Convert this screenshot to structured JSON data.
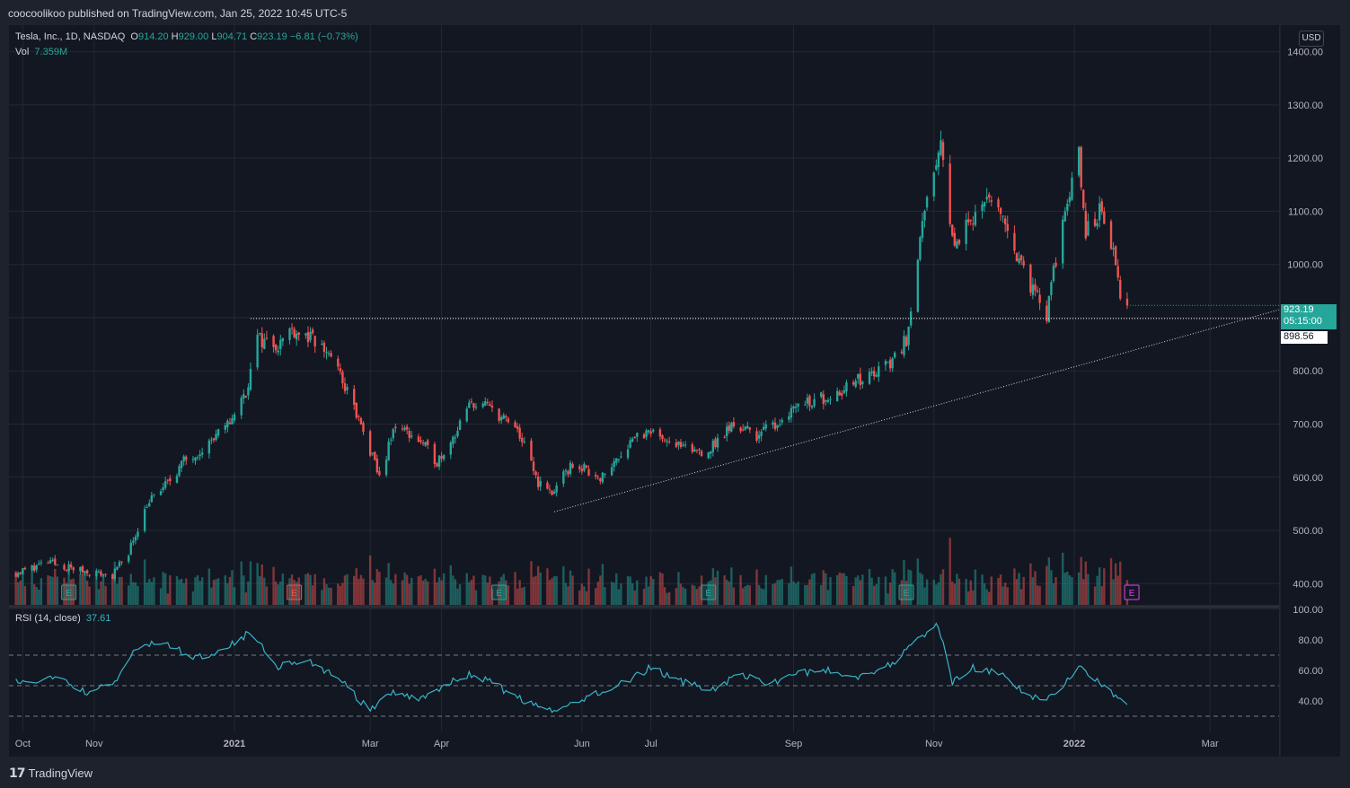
{
  "header": {
    "publisher": "coocoolikoo published on TradingView.com, Jan 25, 2022 10:45 UTC-5"
  },
  "legend": {
    "symbol": "Tesla, Inc., 1D, NASDAQ",
    "o_label": "O",
    "o_value": "914.20",
    "h_label": "H",
    "h_value": "929.00",
    "l_label": "L",
    "l_value": "904.71",
    "c_label": "C",
    "c_value": "923.19",
    "change": "−6.81 (−0.73%)",
    "vol_label": "Vol",
    "vol_value": "7.359M",
    "rsi_label": "RSI (14, close)",
    "rsi_value": "37.61"
  },
  "price_scale": {
    "currency": "USD",
    "last_price": "923.19",
    "countdown": "05:15:00",
    "reference_price": "898.56"
  },
  "footer": {
    "brand": "TradingView"
  },
  "colors": {
    "background": "#131722",
    "up": "#26a69a",
    "down": "#ef5350",
    "rsi": "#38b4c4",
    "earnings_up": "#26a69a",
    "earnings_down": "#ef5350",
    "earnings_upcoming": "#e040fb"
  },
  "chart_data": [
    {
      "type": "candlestick",
      "title": "Tesla, Inc., 1D, NASDAQ",
      "ylim": [
        360,
        1450
      ],
      "y_ticks": [
        "1400.00",
        "1300.00",
        "1200.00",
        "1100.00",
        "1000.00",
        "900.00",
        "800.00",
        "700.00",
        "600.00",
        "500.00",
        "400.00"
      ],
      "x_ticks": [
        "Oct",
        "Nov",
        "2021",
        "Mar",
        "Apr",
        "Jun",
        "Jul",
        "Sep",
        "Nov",
        "2022",
        "Mar"
      ],
      "x_range": [
        "2020-09-25",
        "2022-03-31"
      ],
      "x_tick_dates": [
        "2020-10-01",
        "2020-11-01",
        "2021-01-01",
        "2021-03-01",
        "2021-04-01",
        "2021-06-01",
        "2021-07-01",
        "2021-09-01",
        "2021-11-01",
        "2022-01-01",
        "2022-03-01"
      ],
      "price_path": [
        [
          "2020-09-28",
          420
        ],
        [
          "2020-10-12",
          440
        ],
        [
          "2020-10-26",
          425
        ],
        [
          "2020-11-09",
          415
        ],
        [
          "2020-11-16",
          460
        ],
        [
          "2020-11-24",
          550
        ],
        [
          "2020-12-02",
          585
        ],
        [
          "2020-12-10",
          630
        ],
        [
          "2020-12-18",
          655
        ],
        [
          "2020-12-28",
          690
        ],
        [
          "2021-01-06",
          760
        ],
        [
          "2021-01-11",
          860
        ],
        [
          "2021-01-20",
          850
        ],
        [
          "2021-01-26",
          880
        ],
        [
          "2021-02-03",
          860
        ],
        [
          "2021-02-12",
          830
        ],
        [
          "2021-02-22",
          730
        ],
        [
          "2021-03-05",
          600
        ],
        [
          "2021-03-12",
          700
        ],
        [
          "2021-03-22",
          670
        ],
        [
          "2021-03-30",
          630
        ],
        [
          "2021-04-08",
          690
        ],
        [
          "2021-04-14",
          740
        ],
        [
          "2021-04-23",
          730
        ],
        [
          "2021-05-05",
          680
        ],
        [
          "2021-05-13",
          590
        ],
        [
          "2021-05-19",
          570
        ],
        [
          "2021-05-28",
          625
        ],
        [
          "2021-06-10",
          600
        ],
        [
          "2021-06-24",
          680
        ],
        [
          "2021-07-06",
          680
        ],
        [
          "2021-07-16",
          650
        ],
        [
          "2021-07-26",
          650
        ],
        [
          "2021-08-06",
          700
        ],
        [
          "2021-08-16",
          680
        ],
        [
          "2021-08-24",
          700
        ],
        [
          "2021-09-03",
          740
        ],
        [
          "2021-09-14",
          750
        ],
        [
          "2021-09-24",
          770
        ],
        [
          "2021-10-04",
          790
        ],
        [
          "2021-10-13",
          815
        ],
        [
          "2021-10-20",
          860
        ],
        [
          "2021-10-25",
          1020
        ],
        [
          "2021-10-29",
          1110
        ],
        [
          "2021-11-04",
          1220
        ],
        [
          "2021-11-10",
          1030
        ],
        [
          "2021-11-17",
          1090
        ],
        [
          "2021-11-24",
          1120
        ],
        [
          "2021-12-02",
          1080
        ],
        [
          "2021-12-08",
          1010
        ],
        [
          "2021-12-14",
          950
        ],
        [
          "2021-12-20",
          900
        ],
        [
          "2021-12-27",
          1090
        ],
        [
          "2022-01-03",
          1200
        ],
        [
          "2022-01-06",
          1060
        ],
        [
          "2022-01-12",
          1100
        ],
        [
          "2022-01-18",
          1020
        ],
        [
          "2022-01-21",
          945
        ],
        [
          "2022-01-24",
          923.19
        ]
      ],
      "reference_level": 898.56,
      "trendline": [
        [
          "2021-05-20",
          535
        ],
        [
          "2022-03-31",
          915
        ]
      ],
      "earnings_markers": [
        {
          "date": "2020-10-21",
          "label": "E",
          "kind": "up"
        },
        {
          "date": "2021-01-27",
          "label": "E",
          "kind": "down"
        },
        {
          "date": "2021-04-26",
          "label": "E",
          "kind": "up"
        },
        {
          "date": "2021-07-26",
          "label": "E",
          "kind": "up"
        },
        {
          "date": "2021-10-20",
          "label": "E",
          "kind": "up"
        },
        {
          "date": "2022-01-26",
          "label": "E",
          "kind": "upcoming"
        }
      ]
    },
    {
      "type": "line",
      "title": "RSI (14, close)",
      "ylim": [
        20,
        100
      ],
      "y_ticks": [
        "100.00",
        "80.00",
        "60.00",
        "40.00"
      ],
      "bands": [
        30,
        50,
        70
      ],
      "rsi_path": [
        [
          "2020-09-28",
          52
        ],
        [
          "2020-10-15",
          55
        ],
        [
          "2020-10-30",
          45
        ],
        [
          "2020-11-10",
          52
        ],
        [
          "2020-11-20",
          76
        ],
        [
          "2020-12-01",
          78
        ],
        [
          "2020-12-15",
          68
        ],
        [
          "2020-12-28",
          75
        ],
        [
          "2021-01-08",
          85
        ],
        [
          "2021-01-20",
          63
        ],
        [
          "2021-02-01",
          67
        ],
        [
          "2021-02-15",
          55
        ],
        [
          "2021-03-01",
          33
        ],
        [
          "2021-03-10",
          45
        ],
        [
          "2021-03-22",
          42
        ],
        [
          "2021-04-05",
          52
        ],
        [
          "2021-04-15",
          58
        ],
        [
          "2021-04-27",
          48
        ],
        [
          "2021-05-10",
          38
        ],
        [
          "2021-05-20",
          32
        ],
        [
          "2021-06-02",
          42
        ],
        [
          "2021-06-20",
          52
        ],
        [
          "2021-07-01",
          62
        ],
        [
          "2021-07-15",
          52
        ],
        [
          "2021-07-28",
          48
        ],
        [
          "2021-08-10",
          58
        ],
        [
          "2021-08-20",
          50
        ],
        [
          "2021-09-01",
          58
        ],
        [
          "2021-09-15",
          60
        ],
        [
          "2021-09-30",
          56
        ],
        [
          "2021-10-15",
          66
        ],
        [
          "2021-10-25",
          80
        ],
        [
          "2021-11-03",
          90
        ],
        [
          "2021-11-09",
          52
        ],
        [
          "2021-11-18",
          62
        ],
        [
          "2021-11-30",
          57
        ],
        [
          "2021-12-10",
          45
        ],
        [
          "2021-12-20",
          40
        ],
        [
          "2022-01-03",
          62
        ],
        [
          "2022-01-10",
          55
        ],
        [
          "2022-01-18",
          45
        ],
        [
          "2022-01-24",
          37.61
        ]
      ]
    }
  ]
}
